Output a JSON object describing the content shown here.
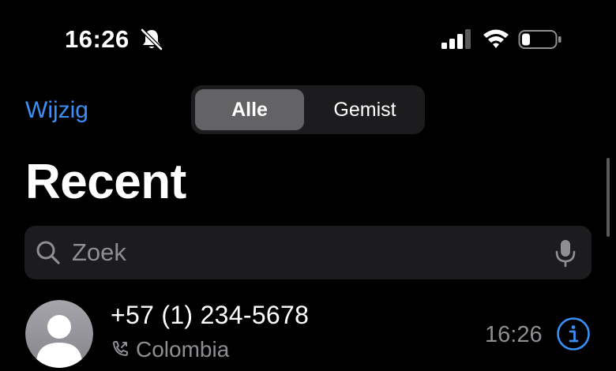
{
  "status_bar": {
    "time": "16:26",
    "icons": [
      "bell-slash-icon",
      "cellular-signal-icon",
      "wifi-icon",
      "battery-icon"
    ]
  },
  "nav": {
    "edit_label": "Wijzig",
    "segments": [
      {
        "label": "Alle",
        "selected": true
      },
      {
        "label": "Gemist",
        "selected": false
      }
    ]
  },
  "page": {
    "title": "Recent"
  },
  "search": {
    "placeholder": "Zoek",
    "value": ""
  },
  "calls": [
    {
      "number": "+57 (1) 234-5678",
      "location": "Colombia",
      "time": "16:26",
      "type_icon": "phone-outgoing-icon"
    }
  ],
  "colors": {
    "background": "#000000",
    "accent": "#3a8ff7",
    "secondary_text": "#8e8e93",
    "control_bg": "#1c1c1e",
    "segment_selected": "#636366"
  }
}
